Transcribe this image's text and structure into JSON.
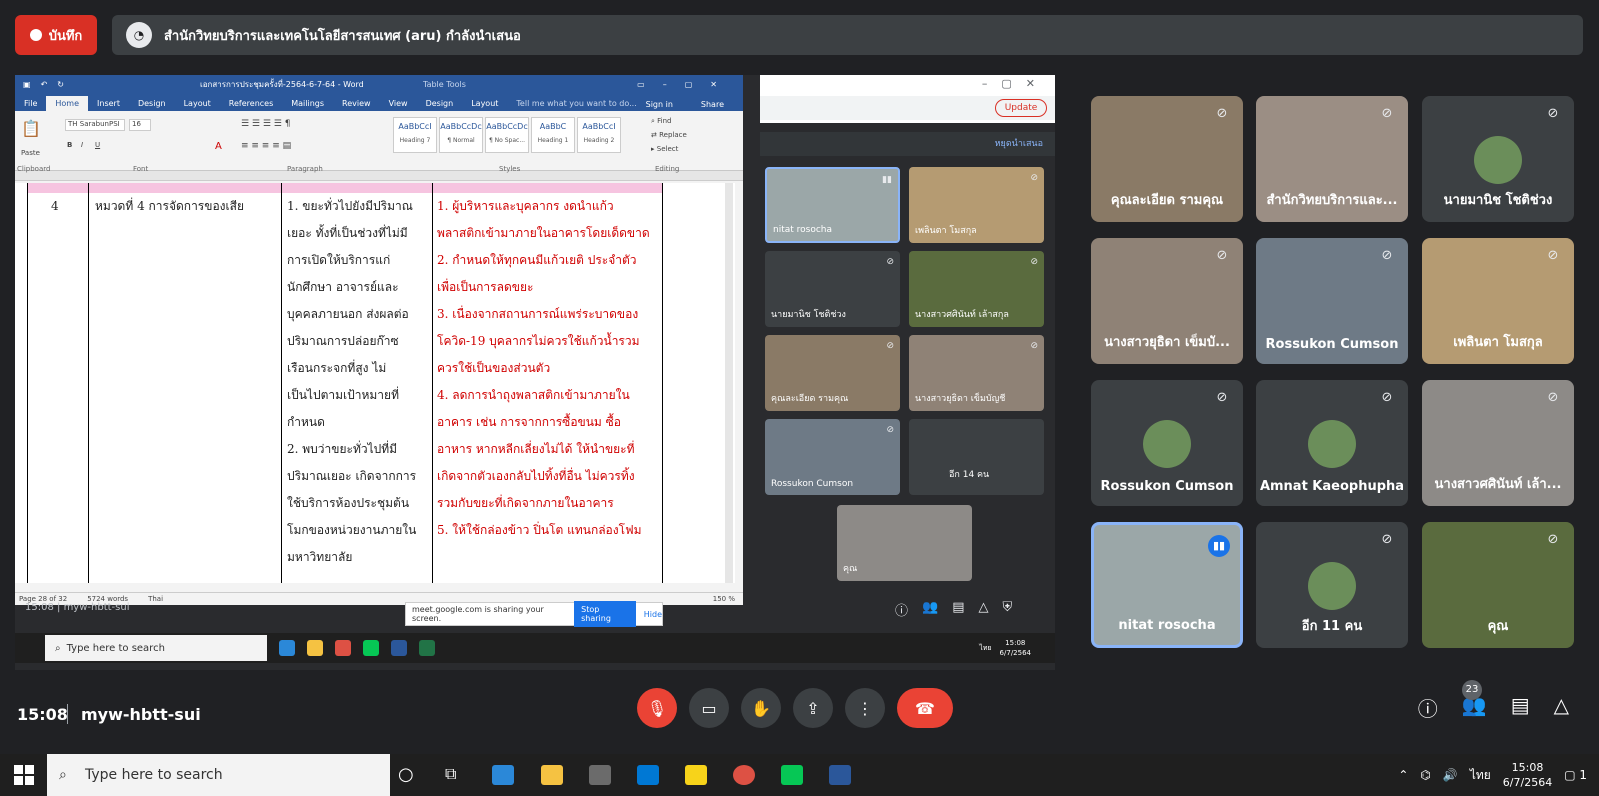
{
  "header": {
    "record_label": "บันทึก",
    "presenter_text": "สำนักวิทยบริการและเทคโนโลยีสารสนเทศ (aru) กำลังนำเสนอ"
  },
  "word": {
    "doc_title": "เอกสารการประชุมครั้งที่-2564-6-7-64 - Word",
    "table_tools": "Table Tools",
    "tabs": [
      "File",
      "Home",
      "Insert",
      "Design",
      "Layout",
      "References",
      "Mailings",
      "Review",
      "View",
      "Design",
      "Layout"
    ],
    "tell_me": "Tell me what you want to do...",
    "sign_in": "Sign in",
    "share": "Share",
    "font_name": "TH SarabunPSI",
    "font_size": "16",
    "styles": [
      {
        "sample": "AaBbCcI",
        "label": "Heading 7"
      },
      {
        "sample": "AaBbCcDc",
        "label": "¶ Normal"
      },
      {
        "sample": "AaBbCcDc",
        "label": "¶ No Spac..."
      },
      {
        "sample": "AaBbC",
        "label": "Heading 1"
      },
      {
        "sample": "AaBbCcI",
        "label": "Heading 2"
      }
    ],
    "find": "Find",
    "replace": "Replace",
    "select": "Select",
    "groups": [
      "Clipboard",
      "Font",
      "Paragraph",
      "Styles",
      "Editing"
    ],
    "paste": "Paste",
    "row_num": "4",
    "col2": "หมวดที่ 4 การจัดการของเสีย",
    "col3": [
      "1. ขยะทั่วไปยังมีปริมาณ",
      "เยอะ ทั้งที่เป็นช่วงที่ไม่มี",
      "การเปิดให้บริการแก่",
      "นักศึกษา อาจารย์และ",
      "บุคคลภายนอก ส่งผลต่อ",
      "ปริมาณการปล่อยก๊าซ",
      "เรือนกระจกที่สูง ไม่",
      "เป็นไปตามเป้าหมายที่",
      "กำหนด",
      "2. พบว่าขยะทั่วไปที่มี",
      "ปริมาณเยอะ เกิดจากการ",
      "ใช้บริการห้องประชุมต้น",
      "โมกของหน่วยงานภายใน",
      "มหาวิทยาลัย"
    ],
    "col4": [
      "1. ผู้บริหารและบุคลากร งดนำแก้ว",
      "พลาสติกเข้ามาภายในอาคารโดยเด็ดขาด",
      "2. กำหนดให้ทุกคนมีแก้วเยติ ประจำตัว",
      "เพื่อเป็นการลดขยะ",
      "3. เนื่องจากสถานการณ์แพร่ระบาดของ",
      "โควิด-19 บุคลากรไม่ควรใช้แก้วน้ำรวม",
      "ควรใช้เป็นของส่วนตัว",
      "4. ลดการนำถุงพลาสติกเข้ามาภายใน",
      "อาคาร เช่น การจากการซื้อขนม ซื้อ",
      "อาหาร หากหลีกเลี่ยงไม่ได้ ให้นำขยะที่",
      "เกิดจากตัวเองกลับไปทิ้งที่อื่น ไม่ควรทิ้ง",
      "รวมกับขยะที่เกิดจากภายในอาคาร",
      "5. ให้ใช้กล่องข้าว ปิ่นโต แทนกล่องโฟม"
    ],
    "status_page": "Page 28 of 32",
    "status_words": "5724 words",
    "status_lang": "Thai",
    "zoom": "150 %"
  },
  "chrome": {
    "update_label": "Update"
  },
  "inner_meet": {
    "stop_presenting": "หยุดนำเสนอ",
    "tiles": [
      {
        "name": "nitat rosocha",
        "speaking": true
      },
      {
        "name": "เพลินตา โมสกุล",
        "speaking": false
      },
      {
        "name": "นายมานิช โชติช่วง",
        "speaking": false
      },
      {
        "name": "นางสาวศศินันท์ เล้าสกุล",
        "speaking": false
      },
      {
        "name": "คุณละเอียด รามคุณ",
        "speaking": false
      },
      {
        "name": "นางสาวยุธิดา เข็มบัญชี",
        "speaking": false
      },
      {
        "name": "Rossukon Cumson",
        "speaking": false
      },
      {
        "name": "อีก 14 คน",
        "speaking": false
      },
      {
        "name": "คุณ",
        "speaking": false
      }
    ],
    "badge": "23",
    "time": "15:08",
    "code": "myw-hbtt-sui"
  },
  "sharing_bar": {
    "text": "meet.google.com is sharing your screen.",
    "stop": "Stop sharing",
    "hide": "Hide"
  },
  "inner_taskbar": {
    "search": "Type here to search",
    "time": "15:08",
    "date": "6/7/2564",
    "lang": "ไทย"
  },
  "participants": [
    {
      "name": "คุณละเอียด รามคุณ",
      "speaking": false,
      "type": "video",
      "color": "#8a7a66"
    },
    {
      "name": "สำนักวิทยบริการและ...",
      "speaking": false,
      "type": "video",
      "color": "#9b8e84"
    },
    {
      "name": "นายมานิช โชติช่วง",
      "speaking": false,
      "type": "avatar",
      "color": "#3c4043"
    },
    {
      "name": "นางสาวยุธิดา เข็มบั...",
      "speaking": false,
      "type": "video",
      "color": "#8f8276"
    },
    {
      "name": "Rossukon Cumson",
      "speaking": false,
      "type": "video",
      "color": "#6e7a86"
    },
    {
      "name": "เพลินตา โมสกุล",
      "speaking": false,
      "type": "video",
      "color": "#b59b72"
    },
    {
      "name": "Rossukon Cumson",
      "speaking": false,
      "type": "avatar",
      "color": "#3c4043"
    },
    {
      "name": "Amnat Kaeophupha",
      "speaking": false,
      "type": "avatar",
      "color": "#3c4043"
    },
    {
      "name": "นางสาวศศินันท์ เล้า...",
      "speaking": false,
      "type": "video",
      "color": "#8d8a87"
    },
    {
      "name": "nitat rosocha",
      "speaking": true,
      "type": "video",
      "color": "#9ba7a8"
    },
    {
      "name": "อีก 11 คน",
      "speaking": false,
      "type": "avatar",
      "color": "#3c4043"
    },
    {
      "name": "คุณ",
      "speaking": false,
      "type": "video",
      "color": "#5a6b3e"
    }
  ],
  "footer": {
    "time": "15:08",
    "meeting_code": "myw-hbtt-sui",
    "people_badge": "23"
  },
  "taskbar": {
    "search": "Type here to search",
    "time": "15:08",
    "date": "6/7/2564",
    "lang": "ไทย",
    "notif": "1"
  }
}
